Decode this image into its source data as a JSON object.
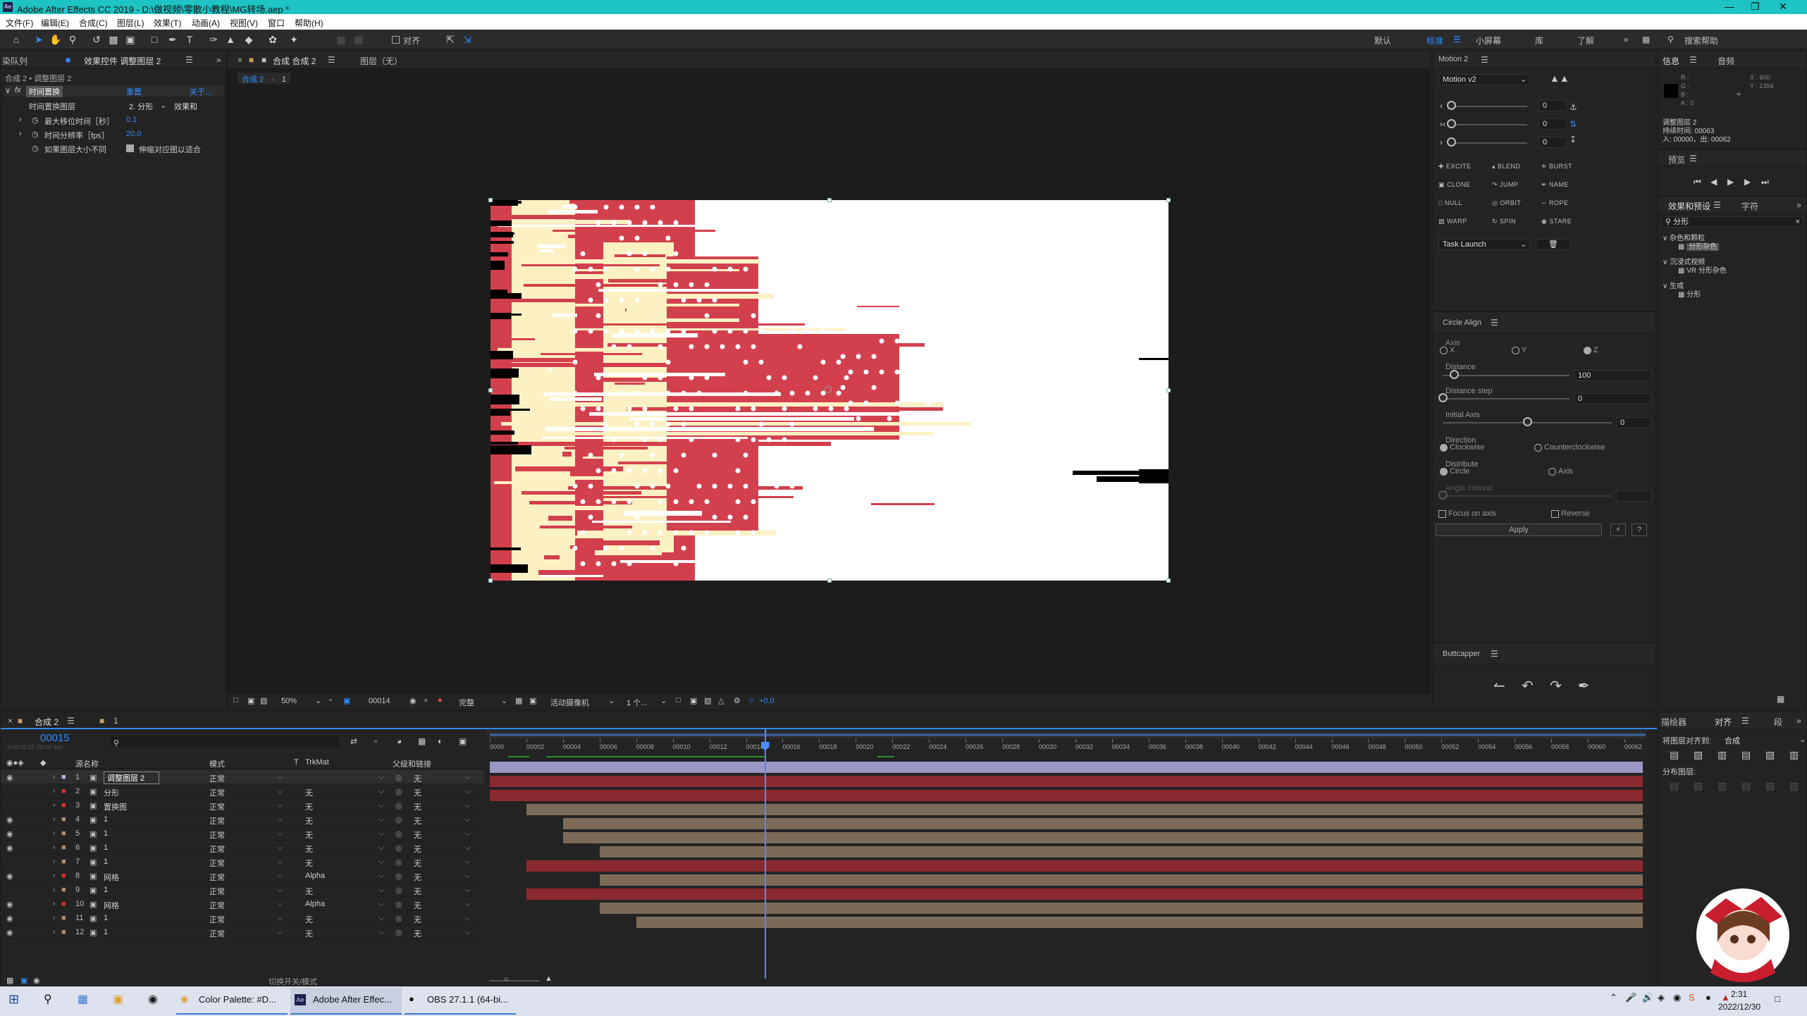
{
  "window": {
    "title": "Adobe After Effects CC 2019 - D:\\做视频\\零散小教程\\MG转场.aep *",
    "icon_text": "Ae",
    "controls": [
      "minimize-icon",
      "restore-icon",
      "close-icon"
    ]
  },
  "menu": [
    "文件(F)",
    "编辑(E)",
    "合成(C)",
    "图层(L)",
    "效果(T)",
    "动画(A)",
    "视图(V)",
    "窗口",
    "帮助(H)"
  ],
  "toolbar": {
    "align_label": "对齐",
    "workspaces": [
      "默认",
      "标准",
      "小屏幕",
      "库",
      "了解"
    ],
    "active_workspace": "标准",
    "search_help": "搜索帮助"
  },
  "left_panel": {
    "tabs": [
      "染队列",
      "效果控件 调整图层 2"
    ],
    "breadcrumb": "合成 2 • 调整图层 2",
    "effect_name": "时间置换",
    "reset": "重置",
    "about": "关于...",
    "props": [
      {
        "label": "时间置换图层",
        "value": "2. 分形",
        "extra": "效果和"
      },
      {
        "label": "最大移位时间［秒］",
        "value": "0.1"
      },
      {
        "label": "时间分辨率［fps］",
        "value": "20.0"
      },
      {
        "label": "如果图层大小不同",
        "value": "伸缩对应图以适合"
      }
    ]
  },
  "viewer": {
    "tabs": [
      "合成 合成 2",
      "图层（无）"
    ],
    "sub_tabs": [
      "合成 2",
      "1"
    ],
    "bottom": {
      "zoom": "50%",
      "timecode": "00014",
      "quality": "完整",
      "camera": "活动摄像机",
      "views": "1 个...",
      "exposure": "+0.0"
    }
  },
  "motion_panel": {
    "title": "Motion 2",
    "preset": "Motion v2",
    "slider_values": [
      "0",
      "0",
      "0"
    ],
    "buttons": [
      "EXCITE",
      "BLEND",
      "BURST",
      "CLONE",
      "JUMP",
      "NAME",
      "NULL",
      "ORBIT",
      "ROPE",
      "WARP",
      "SPIN",
      "STARE"
    ],
    "task": "Task Launch"
  },
  "circle_align": {
    "title": "Circle Align",
    "axis_label": "Axis",
    "axis_options": [
      "X",
      "Y",
      "Z"
    ],
    "axis_selected": "Z",
    "distance_label": "Distance",
    "distance_value": "100",
    "distance_step_label": "Distance step",
    "distance_step_value": "0",
    "initial_axis_label": "Initial Axis",
    "initial_axis_value": "0",
    "direction_label": "Direction",
    "direction_options": [
      "Clockwise",
      "Counterclockwise"
    ],
    "direction_selected": "Clockwise",
    "distribute_label": "Distribute",
    "distribute_options": [
      "Circle",
      "Axis"
    ],
    "distribute_selected": "Circle",
    "angle_interval_label": "Angle interval",
    "focus_label": "Focus on axis",
    "reverse_label": "Reverse",
    "apply_label": "Apply"
  },
  "buttcapper": {
    "title": "Buttcapper"
  },
  "info_panel": {
    "tabs": [
      "信息",
      "音频"
    ],
    "r": "R :",
    "g": "G :",
    "b": "B :",
    "a": "A : 0",
    "x": "X : 600",
    "y": "Y : 1394",
    "layer": "调整图层 2",
    "duration": "持续时间: 00063",
    "in_out": "入: 00000，出: 00062"
  },
  "preview_panel": {
    "title": "预览"
  },
  "effects_panel": {
    "tabs": [
      "效果和预设",
      "字符"
    ],
    "search": "分形",
    "tree": [
      {
        "group": "杂色和颗粒",
        "item": "分形杂色"
      },
      {
        "group": "沉浸式视频",
        "item": "VR 分形杂色"
      },
      {
        "group": "生成",
        "item": "分形"
      }
    ]
  },
  "align_panel": {
    "tabs": [
      "描绘器",
      "对齐",
      "段"
    ],
    "align_to_label": "将图层对齐到:",
    "align_to_value": "合成",
    "distribute_label": "分布图层:"
  },
  "timeline": {
    "tab": "合成 2",
    "tab2": "1",
    "timecode": "00015",
    "timecode_sub": "0:00:00:15 (30.00 fps)",
    "columns": [
      "源名称",
      "模式",
      "T",
      "TrkMat",
      "父级和链接"
    ],
    "ruler": [
      "0000",
      "00002",
      "00004",
      "00006",
      "00008",
      "00010",
      "00012",
      "00014",
      "00016",
      "00018",
      "00020",
      "00022",
      "00024",
      "00026",
      "00028",
      "00030",
      "00032",
      "00034",
      "00036",
      "00038",
      "00040",
      "00042",
      "00044",
      "00046",
      "00048",
      "00050",
      "00052",
      "00054",
      "00056",
      "00058",
      "00060",
      "00062"
    ],
    "playhead_frame": 15,
    "total_frames": 63,
    "footer": "切换开关/模式",
    "layers": [
      {
        "num": "1",
        "name": "调整图层 2",
        "mode": "正常",
        "trk": "",
        "parent": "无",
        "label": "#b8b8d8",
        "bar": "#9b97c4",
        "start": 0,
        "visible": true,
        "selected": true
      },
      {
        "num": "2",
        "name": "分形",
        "mode": "正常",
        "trk": "无",
        "parent": "无",
        "label": "#c33",
        "bar": "#8b2a2e",
        "start": 0,
        "visible": false
      },
      {
        "num": "3",
        "name": "置换图",
        "mode": "正常",
        "trk": "无",
        "parent": "无",
        "label": "#c33",
        "bar": "#8b2a2e",
        "start": 0,
        "visible": false
      },
      {
        "num": "4",
        "name": "1",
        "mode": "正常",
        "trk": "无",
        "parent": "无",
        "label": "#a89070",
        "bar": "#7a6a57",
        "start": 2,
        "visible": true
      },
      {
        "num": "5",
        "name": "1",
        "mode": "正常",
        "trk": "无",
        "parent": "无",
        "label": "#a89070",
        "bar": "#7a6a57",
        "start": 4,
        "visible": true
      },
      {
        "num": "6",
        "name": "1",
        "mode": "正常",
        "trk": "无",
        "parent": "无",
        "label": "#a89070",
        "bar": "#7a6a57",
        "start": 4,
        "visible": true
      },
      {
        "num": "7",
        "name": "1",
        "mode": "正常",
        "trk": "无",
        "parent": "无",
        "label": "#a89070",
        "bar": "#7a6a57",
        "start": 6,
        "visible": false
      },
      {
        "num": "8",
        "name": "网格",
        "mode": "正常",
        "trk": "Alpha",
        "parent": "无",
        "label": "#c33",
        "bar": "#8b2a2e",
        "start": 2,
        "visible": true
      },
      {
        "num": "9",
        "name": "1",
        "mode": "正常",
        "trk": "无",
        "parent": "无",
        "label": "#a89070",
        "bar": "#7a6a57",
        "start": 6,
        "visible": false
      },
      {
        "num": "10",
        "name": "网格",
        "mode": "正常",
        "trk": "Alpha",
        "parent": "无",
        "label": "#c33",
        "bar": "#8b2a2e",
        "start": 2,
        "visible": true
      },
      {
        "num": "11",
        "name": "1",
        "mode": "正常",
        "trk": "无",
        "parent": "无",
        "label": "#a89070",
        "bar": "#7a6a57",
        "start": 6,
        "visible": true
      },
      {
        "num": "12",
        "name": "1",
        "mode": "正常",
        "trk": "无",
        "parent": "无",
        "label": "#a89070",
        "bar": "#7a6a57",
        "start": 8,
        "visible": true
      }
    ]
  },
  "taskbar": {
    "apps": [
      {
        "label": "Color Palette: #D...",
        "icon": "chrome-icon"
      },
      {
        "label": "Adobe After Effec...",
        "icon": "ae-icon"
      },
      {
        "label": "OBS 27.1.1 (64-bi...",
        "icon": "obs-icon"
      }
    ],
    "time": "2:31",
    "date": "2022/12/30"
  },
  "colors": {
    "accent": "#2f8cff",
    "title_bar": "#1ec3c3",
    "comp_red": "#d3404d",
    "comp_cream": "#fdf1c4",
    "comp_black": "#000000"
  }
}
